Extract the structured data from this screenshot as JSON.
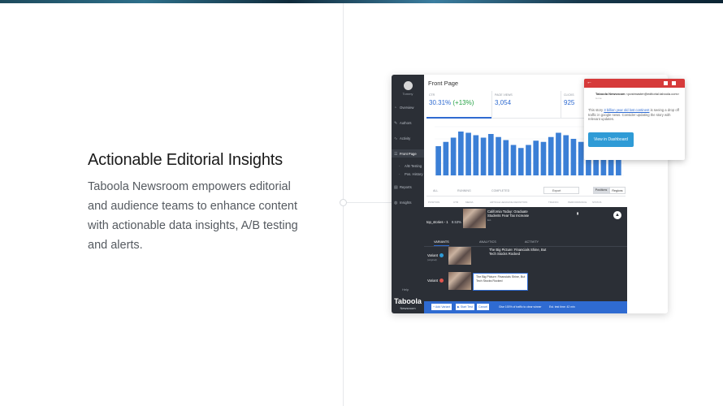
{
  "content": {
    "heading": "Actionable Editorial Insights",
    "description": "Taboola Newsroom empowers editorial and audience teams to enhance content with actionable data insights, A/B testing and alerts."
  },
  "app": {
    "user_name": "Tommy",
    "nav": [
      {
        "label": "Overview",
        "icon": "◔"
      },
      {
        "label": "Authors",
        "icon": "✎"
      },
      {
        "label": "Activity",
        "icon": "∿"
      },
      {
        "label": "Front Page",
        "icon": "☰"
      },
      {
        "label": "A/B Testing",
        "icon": "·"
      },
      {
        "label": "Pos. History",
        "icon": "·"
      },
      {
        "label": "Reports",
        "icon": "▤"
      },
      {
        "label": "Insights",
        "icon": "◍"
      }
    ],
    "help": "Help",
    "logo": "Taboola",
    "logo_sub": "Newsroom",
    "page_title": "Front Page",
    "metrics": [
      {
        "label": "CTR",
        "value": "30.31%",
        "change": "(+13%)"
      },
      {
        "label": "PAGE VIEWS",
        "value": "3,054"
      },
      {
        "label": "CLICKS",
        "value": "925"
      }
    ],
    "filters": {
      "all": "ALL",
      "running": "RUNNING",
      "completed": "COMPLETED",
      "select": "Export",
      "btn_positions": "Positions",
      "btn_regions": "Regions"
    },
    "table_headers": [
      "POSITION",
      "CTR",
      "MEDIA",
      "ARTICLE HEADLINE DEFINITION",
      "TRAFFIC",
      "PERFORMANCE",
      "STATUS"
    ],
    "row1": {
      "position": "top_stories - 1",
      "ctr": "8.53%",
      "headline": "California Today: Graduate Students Fear Tax Increase",
      "sub": "Ext.",
      "icon": "▮",
      "chevron": "▲"
    },
    "tabs": [
      "VARIANTS",
      "ANALYTICS",
      "ACTIVITY"
    ],
    "variants": [
      {
        "label": "Variant",
        "sub": "(original)",
        "headline": "The Big Picture: Financials Shine, But Tech Stocks Rocked"
      },
      {
        "label": "Variant",
        "headline": "The Big Picture: Financials Shine, But Tech Stocks Rocked"
      }
    ],
    "bottom": {
      "add_variant": "+ Add Variant",
      "start_test": "▶ Start Test",
      "cancel": "Cancel",
      "note": "Give 100% of traffic to clear winner",
      "est": "Est. test time: 42 min"
    }
  },
  "email": {
    "sender": "Taboola Newsroom",
    "sender_addr": "<postmaster@editorial.taboola.com>",
    "to": "to me",
    "body_prefix": "This story",
    "body_link": "3 billion year old lost continent",
    "body_rest": "is seeing a drop off traffic in google news. Consider updating the story with relevant updates.",
    "cta": "View in Dashboard"
  },
  "chart_data": {
    "type": "bar",
    "values": [
      48,
      55,
      62,
      72,
      70,
      66,
      62,
      68,
      63,
      58,
      50,
      45,
      50,
      57,
      55,
      63,
      70,
      66,
      60,
      55,
      52,
      40,
      35,
      40,
      38
    ],
    "ylim": [
      0,
      80
    ],
    "color": "#3b7fd6"
  }
}
